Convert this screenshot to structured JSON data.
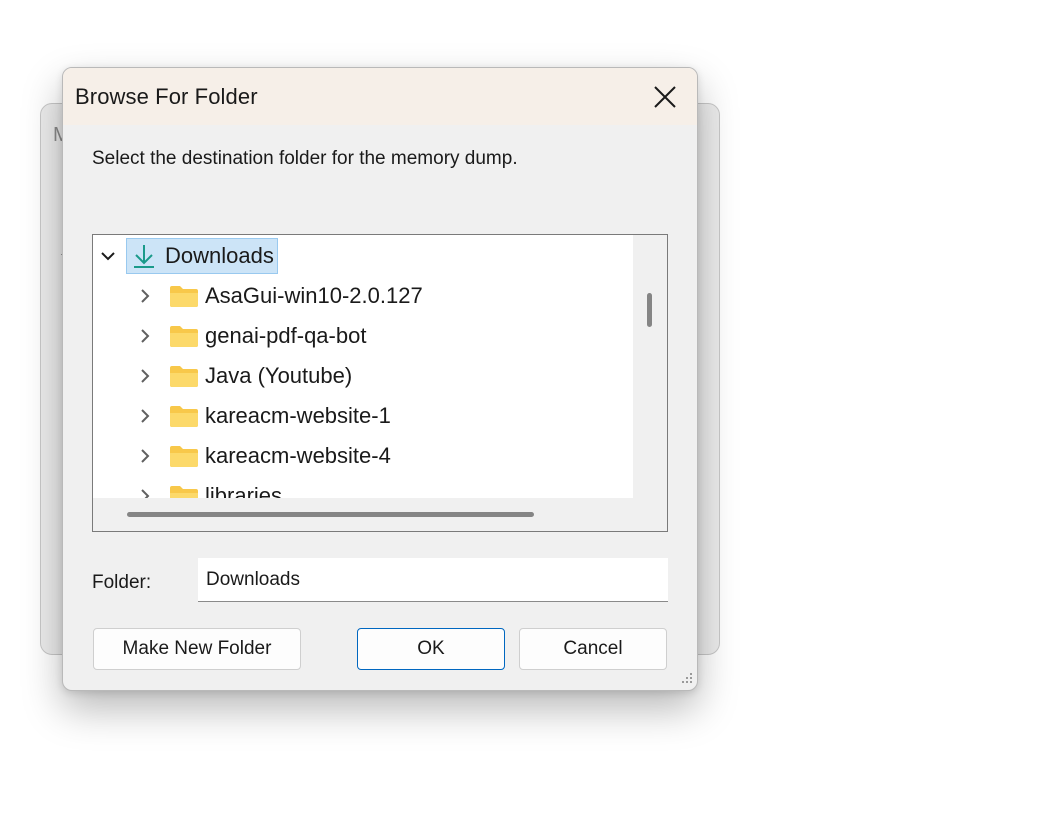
{
  "background_window": {
    "partial_title_letter": "M"
  },
  "dialog": {
    "title": "Browse For Folder",
    "instruction": "Select the destination folder for the memory dump.",
    "tree": {
      "root": {
        "label": "Downloads",
        "icon": "download-icon",
        "expanded": true,
        "selected": true
      },
      "children": [
        {
          "label": "AsaGui-win10-2.0.127",
          "icon": "folder-icon"
        },
        {
          "label": "genai-pdf-qa-bot",
          "icon": "folder-icon"
        },
        {
          "label": "Java (Youtube)",
          "icon": "folder-icon"
        },
        {
          "label": "kareacm-website-1",
          "icon": "folder-icon"
        },
        {
          "label": "kareacm-website-4",
          "icon": "folder-icon"
        },
        {
          "label": "libraries",
          "icon": "folder-icon"
        }
      ]
    },
    "folder_field": {
      "label": "Folder:",
      "value": "Downloads"
    },
    "buttons": {
      "make_new_folder": "Make New Folder",
      "ok": "OK",
      "cancel": "Cancel"
    }
  },
  "colors": {
    "title_bar": "#f6efe8",
    "dialog_bg": "#f0f0f0",
    "selection_bg": "#cce4f7",
    "selection_border": "#99c9ef",
    "accent": "#0067c0",
    "download_icon": "#1a9a8a",
    "folder_yellow": "#f8c84a"
  }
}
